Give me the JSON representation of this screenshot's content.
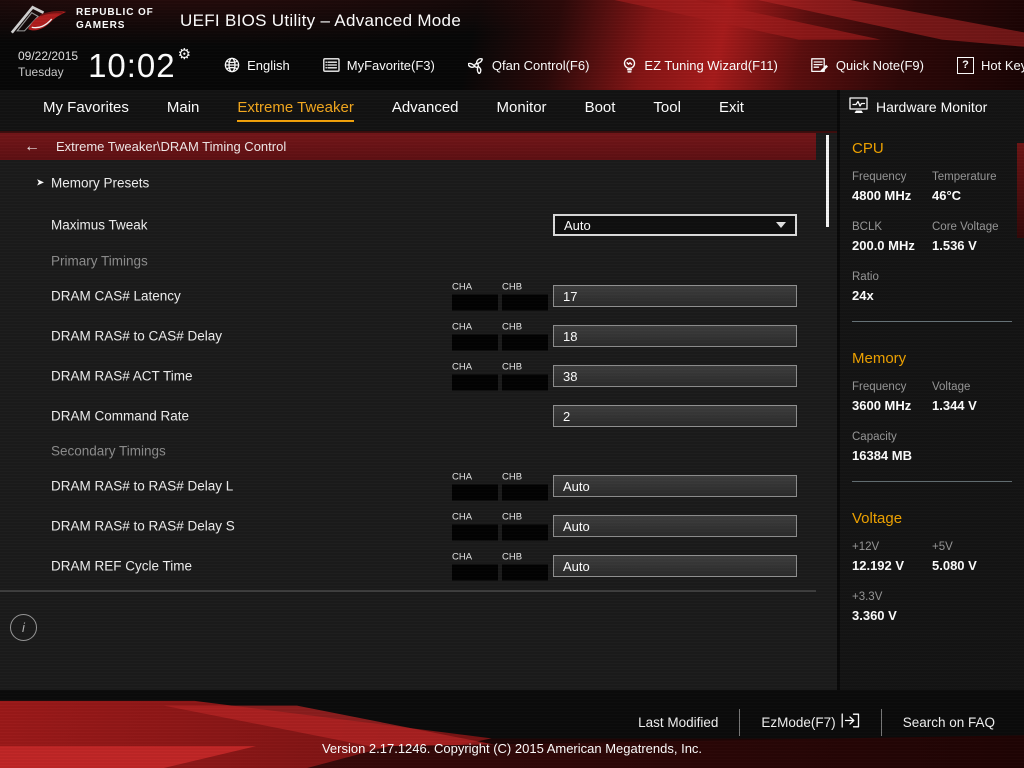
{
  "header": {
    "brand_line1": "REPUBLIC OF",
    "brand_line2": "GAMERS",
    "title": "UEFI BIOS Utility – Advanced Mode"
  },
  "toolbar": {
    "date": "09/22/2015",
    "day": "Tuesday",
    "time": "10:02",
    "items": [
      {
        "label": "English",
        "icon": "globe-icon"
      },
      {
        "label": "MyFavorite(F3)",
        "icon": "favorites-list-icon"
      },
      {
        "label": "Qfan Control(F6)",
        "icon": "fan-icon"
      },
      {
        "label": "EZ Tuning Wizard(F11)",
        "icon": "wizard-bulb-icon"
      },
      {
        "label": "Quick Note(F9)",
        "icon": "note-icon"
      },
      {
        "label": "Hot Keys",
        "icon": "question-icon"
      }
    ]
  },
  "menu": {
    "tabs": [
      {
        "label": "My Favorites",
        "active": false
      },
      {
        "label": "Main",
        "active": false
      },
      {
        "label": "Extreme Tweaker",
        "active": true
      },
      {
        "label": "Advanced",
        "active": false
      },
      {
        "label": "Monitor",
        "active": false
      },
      {
        "label": "Boot",
        "active": false
      },
      {
        "label": "Tool",
        "active": false
      },
      {
        "label": "Exit",
        "active": false
      }
    ]
  },
  "content": {
    "breadcrumb": "Extreme Tweaker\\DRAM Timing Control",
    "rows": [
      {
        "type": "link",
        "label": "Memory Presets"
      },
      {
        "type": "dropdown",
        "label": "Maximus Tweak",
        "value": "Auto"
      },
      {
        "type": "section",
        "label": "Primary Timings"
      },
      {
        "type": "input",
        "label": "DRAM CAS# Latency",
        "channels": [
          "CHA",
          "CHB"
        ],
        "value": "17"
      },
      {
        "type": "input",
        "label": "DRAM RAS# to CAS# Delay",
        "channels": [
          "CHA",
          "CHB"
        ],
        "value": "18"
      },
      {
        "type": "input",
        "label": "DRAM RAS# ACT Time",
        "channels": [
          "CHA",
          "CHB"
        ],
        "value": "38"
      },
      {
        "type": "input",
        "label": "DRAM Command Rate",
        "channels": [],
        "value": "2"
      },
      {
        "type": "section",
        "label": "Secondary Timings"
      },
      {
        "type": "input",
        "label": "DRAM RAS# to RAS# Delay L",
        "channels": [
          "CHA",
          "CHB"
        ],
        "value": "Auto"
      },
      {
        "type": "input",
        "label": "DRAM RAS# to RAS# Delay S",
        "channels": [
          "CHA",
          "CHB"
        ],
        "value": "Auto"
      },
      {
        "type": "input",
        "label": "DRAM REF Cycle Time",
        "channels": [
          "CHA",
          "CHB"
        ],
        "value": "Auto"
      }
    ]
  },
  "sidebar": {
    "title": "Hardware Monitor",
    "sections": [
      {
        "title": "CPU",
        "rows": [
          [
            {
              "label": "Frequency",
              "value": "4800 MHz"
            },
            {
              "label": "Temperature",
              "value": "46°C"
            }
          ],
          [
            {
              "label": "BCLK",
              "value": "200.0 MHz"
            },
            {
              "label": "Core Voltage",
              "value": "1.536 V"
            }
          ],
          [
            {
              "label": "Ratio",
              "value": "24x"
            }
          ]
        ]
      },
      {
        "title": "Memory",
        "rows": [
          [
            {
              "label": "Frequency",
              "value": "3600 MHz"
            },
            {
              "label": "Voltage",
              "value": "1.344 V"
            }
          ],
          [
            {
              "label": "Capacity",
              "value": "16384 MB"
            }
          ]
        ]
      },
      {
        "title": "Voltage",
        "rows": [
          [
            {
              "label": "+12V",
              "value": "12.192 V"
            },
            {
              "label": "+5V",
              "value": "5.080 V"
            }
          ],
          [
            {
              "label": "+3.3V",
              "value": "3.360 V"
            }
          ]
        ]
      }
    ]
  },
  "footer": {
    "last_modified": "Last Modified",
    "ez_mode": "EzMode(F7)",
    "search_faq": "Search on FAQ",
    "version": "Version 2.17.1246. Copyright (C) 2015 American Megatrends, Inc."
  },
  "colors": {
    "accent_gold": "#f2a20a",
    "rog_red": "#a51d1d",
    "breadcrumb_red": "#6b1417",
    "value_white": "#ffffff",
    "label_gray": "#989898"
  }
}
